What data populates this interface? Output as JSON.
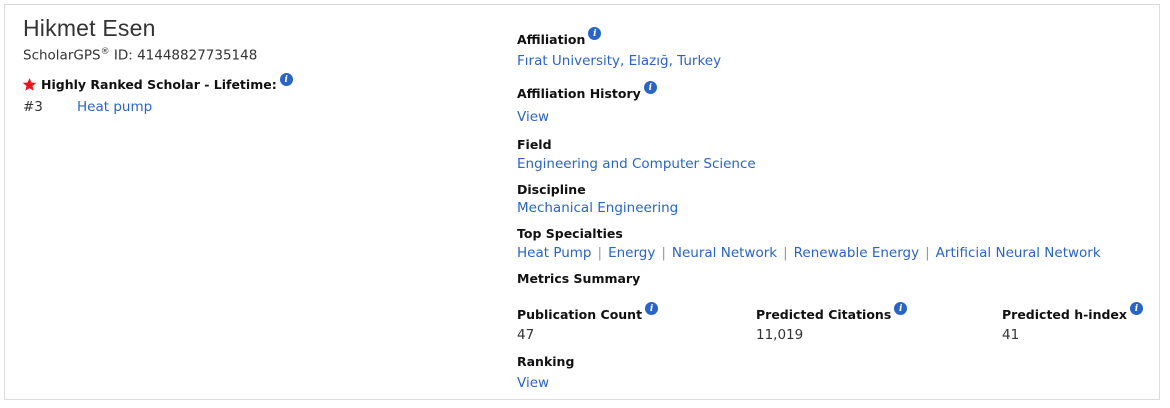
{
  "profile": {
    "name": "Hikmet Esen",
    "id_prefix": "ScholarGPS",
    "id_reg": "®",
    "id_text": " ID: 41448827735148",
    "highly_ranked_label": "Highly Ranked Scholar - Lifetime:",
    "rank_number": "#3",
    "rank_topic": "Heat pump"
  },
  "details": {
    "affiliation_label": "Affiliation",
    "affiliation_value": "Fırat University, Elazığ, Turkey",
    "affiliation_history_label": "Affiliation History",
    "affiliation_history_link": "View",
    "field_label": "Field",
    "field_value": "Engineering and Computer Science",
    "discipline_label": "Discipline",
    "discipline_value": "Mechanical Engineering",
    "top_specialties_label": "Top Specialties",
    "specialties": [
      "Heat Pump",
      "Energy",
      "Neural Network",
      "Renewable Energy",
      "Artificial Neural Network"
    ],
    "metrics_summary_label": "Metrics Summary",
    "publication_count_label": "Publication Count",
    "publication_count": "47",
    "predicted_citations_label": "Predicted Citations",
    "predicted_citations": "11,019",
    "predicted_hindex_label": "Predicted h-index",
    "predicted_hindex": "41",
    "ranking_label": "Ranking",
    "ranking_link": "View"
  },
  "icons": {
    "info": "info-icon",
    "star": "star-icon"
  },
  "colors": {
    "link": "#2a64c5",
    "star": "#e8141b",
    "info": "#2a64c5"
  }
}
